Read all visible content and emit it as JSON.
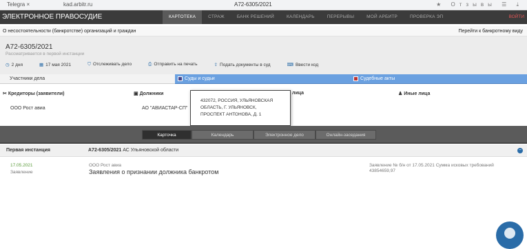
{
  "browser": {
    "back": "←",
    "tab_title": "Telegra",
    "close": "×",
    "url": "kad.arbitr.ru",
    "window_title": "А72-6305/2021",
    "right_icons": "★ Отзывы ☰ ⤓"
  },
  "topnav": {
    "brand": "ЭЛЕКТРОННОЕ ПРАВОСУДИЕ",
    "items": [
      "КАРТОТЕКА",
      "СТРАЖ",
      "БАНК РЕШЕНИЙ",
      "КАЛЕНДАРЬ",
      "ПЕРЕРЫВЫ",
      "МОЙ АРБИТР",
      "ПРОВЕРКА ЭП"
    ],
    "login": "ВОЙТИ"
  },
  "category": {
    "left": "О несостоятельности (банкротстве) организаций и граждан",
    "right": "Перейти к банкротному виду"
  },
  "case": {
    "number": "А72-6305/2021",
    "status": "Рассматривается в первой инстанции",
    "actions": [
      "2 дня",
      "17 мая 2021",
      "Отслеживать дело",
      "Отправить на печать",
      "Подать документы в суд",
      "Ввести код"
    ]
  },
  "sections": [
    "Участники дела",
    "Суды и судьи",
    "Судебные акты"
  ],
  "parties": [
    {
      "h": "Кредиторы (заявители)",
      "v": "ООО Рост авиа"
    },
    {
      "h": "Должники",
      "v": "АО \"АВИАСТАР-СП\""
    },
    {
      "h": "лица",
      "v": ""
    },
    {
      "h": "Иные лица",
      "v": ""
    }
  ],
  "popup": "432072, РОССИЯ, УЛЬЯНОВСКАЯ ОБЛАСТЬ, Г. УЛЬЯНОВСК, ПРОСПЕКТ АНТОНОВА, Д. 1",
  "tabs": [
    "Карточка",
    "Календарь",
    "Электронное дело",
    "Онлайн-заседания"
  ],
  "instance": {
    "label": "Первая инстанция",
    "case_no": "А72-6305/2021",
    "court": "АС Ульяновской области",
    "toggle": "−"
  },
  "entry": {
    "date": "17.05.2021",
    "kind": "Заявление",
    "org": "ООО Рост авиа",
    "title": "Заявления о признании должника банкротом",
    "statement": "Заявление № б/н от 17.05.2021   Сумма исковых требований",
    "sum": "43854659,97"
  }
}
